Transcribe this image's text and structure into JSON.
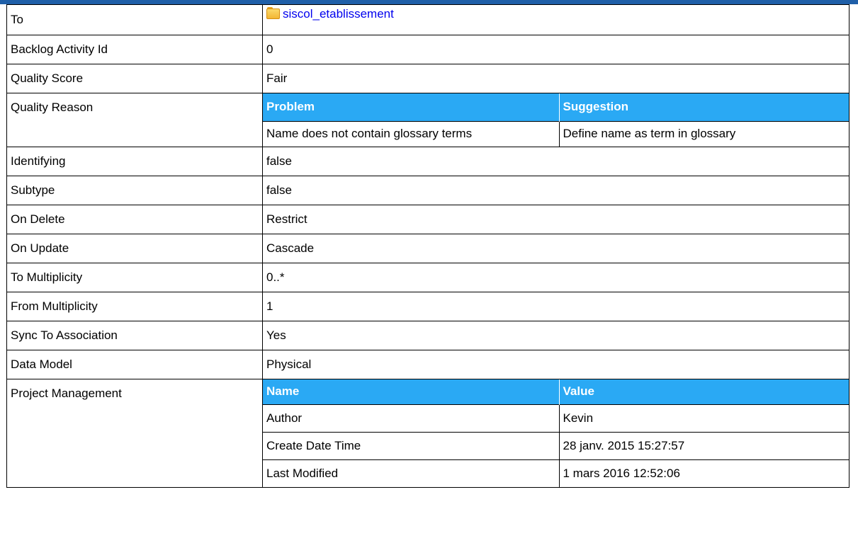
{
  "header_bar_color": "#1f5fa8",
  "header_accent_color": "#2aa9f4",
  "rows": {
    "to": {
      "label": "To",
      "value": "siscol_etablissement",
      "icon": "folder-icon"
    },
    "backlog": {
      "label": "Backlog Activity Id",
      "value": "0"
    },
    "quality_score": {
      "label": "Quality Score",
      "value": "Fair"
    },
    "quality_reason": {
      "label": "Quality Reason",
      "headers": [
        "Problem",
        "Suggestion"
      ],
      "rows": [
        [
          "Name does not contain glossary terms",
          "Define name as term in glossary"
        ]
      ]
    },
    "identifying": {
      "label": "Identifying",
      "value": "false"
    },
    "subtype": {
      "label": "Subtype",
      "value": "false"
    },
    "on_delete": {
      "label": "On Delete",
      "value": "Restrict"
    },
    "on_update": {
      "label": "On Update",
      "value": "Cascade"
    },
    "to_multiplicity": {
      "label": "To Multiplicity",
      "value": "0..*"
    },
    "from_multiplicity": {
      "label": "From Multiplicity",
      "value": "1"
    },
    "sync": {
      "label": "Sync To Association",
      "value": "Yes"
    },
    "data_model": {
      "label": "Data Model",
      "value": "Physical"
    },
    "project_management": {
      "label": "Project Management",
      "headers": [
        "Name",
        "Value"
      ],
      "rows": [
        [
          "Author",
          "Kevin"
        ],
        [
          "Create Date Time",
          "28 janv. 2015 15:27:57"
        ],
        [
          "Last Modified",
          "1 mars 2016 12:52:06"
        ]
      ]
    }
  }
}
